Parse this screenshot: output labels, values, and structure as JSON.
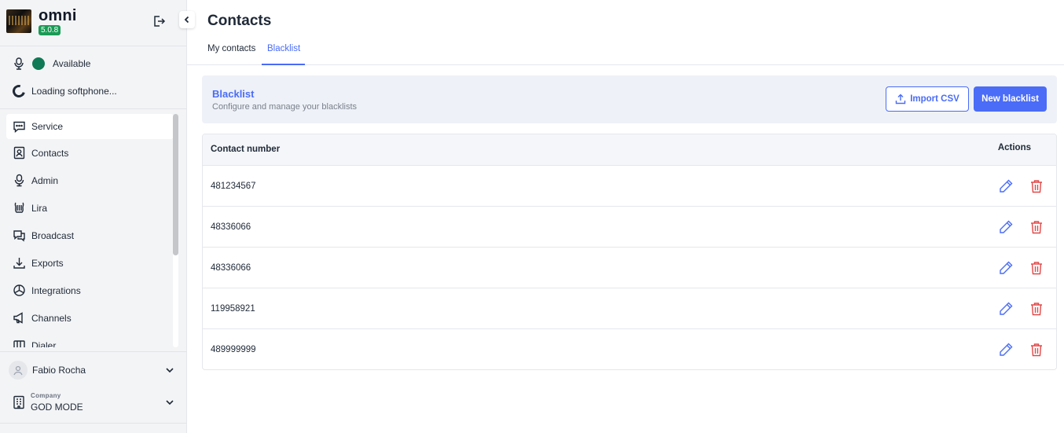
{
  "app": {
    "name": "omni",
    "version": "5.0.8"
  },
  "status": {
    "availability": "Available",
    "softphone": "Loading softphone..."
  },
  "sidebar": {
    "items": [
      {
        "label": "Service",
        "icon": "chat-icon",
        "active": true
      },
      {
        "label": "Contacts",
        "icon": "contact-card-icon"
      },
      {
        "label": "Admin",
        "icon": "headset-icon"
      },
      {
        "label": "Lira",
        "icon": "lira-icon"
      },
      {
        "label": "Broadcast",
        "icon": "broadcast-chat-icon"
      },
      {
        "label": "Exports",
        "icon": "download-icon"
      },
      {
        "label": "Integrations",
        "icon": "integrations-icon"
      },
      {
        "label": "Channels",
        "icon": "megaphone-icon"
      },
      {
        "label": "Dialer",
        "icon": "dialer-icon"
      }
    ]
  },
  "user": {
    "name": "Fabio Rocha"
  },
  "company": {
    "caption": "Company",
    "name": "GOD MODE"
  },
  "page": {
    "title": "Contacts"
  },
  "tabs": [
    {
      "label": "My contacts"
    },
    {
      "label": "Blacklist",
      "active": true
    }
  ],
  "banner": {
    "title": "Blacklist",
    "subtitle": "Configure and manage your blacklists",
    "import_label": "Import CSV",
    "new_label": "New blacklist"
  },
  "table": {
    "headers": {
      "number": "Contact number",
      "actions": "Actions"
    },
    "rows": [
      {
        "number": "481234567"
      },
      {
        "number": "48336066"
      },
      {
        "number": "48336066"
      },
      {
        "number": "119958921"
      },
      {
        "number": "489999999"
      }
    ]
  },
  "colors": {
    "accent": "#4a6cf7",
    "status_green": "#0f7a55",
    "danger": "#e04848",
    "version_badge": "#1a9b55"
  }
}
